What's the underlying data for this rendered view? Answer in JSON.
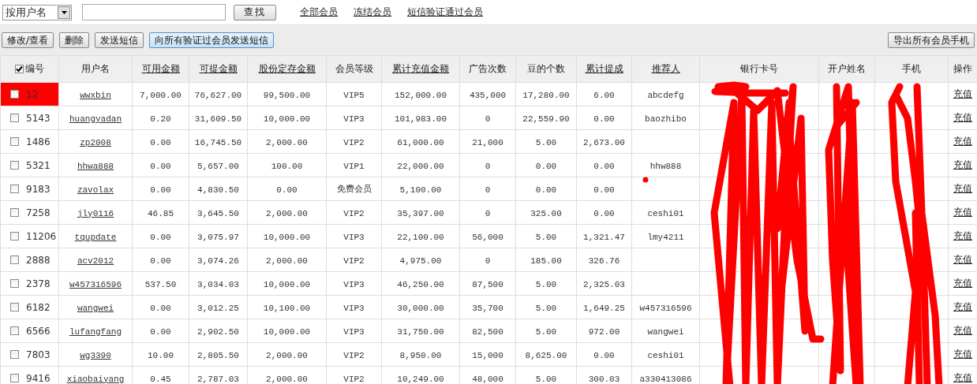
{
  "search": {
    "mode": "按用户名",
    "button": "查找"
  },
  "filter_links": [
    "全部会员",
    "冻结会员",
    "短信验证通过会员"
  ],
  "actions": [
    {
      "label": "修改/查看",
      "kind": "plain"
    },
    {
      "label": "删除",
      "kind": "plain"
    },
    {
      "label": "发送短信",
      "kind": "plain"
    },
    {
      "label": "向所有验证过会员发送短信",
      "kind": "highlight"
    }
  ],
  "export_button": "导出所有会员手机",
  "table": {
    "select_all": {
      "checked": true
    },
    "columns": [
      {
        "label": "编号",
        "sortable": false
      },
      {
        "label": "用户名",
        "sortable": false
      },
      {
        "label": "可用金额",
        "sortable": true
      },
      {
        "label": "可提金额",
        "sortable": true
      },
      {
        "label": "股份定存金额",
        "sortable": true
      },
      {
        "label": "会员等级",
        "sortable": false
      },
      {
        "label": "累计充值金额",
        "sortable": true
      },
      {
        "label": "广告次数",
        "sortable": false
      },
      {
        "label": "豆的个数",
        "sortable": false
      },
      {
        "label": "累计提成",
        "sortable": true
      },
      {
        "label": "推荐人",
        "sortable": true
      },
      {
        "label": "银行卡号",
        "sortable": false
      },
      {
        "label": "开户姓名",
        "sortable": false
      },
      {
        "label": "手机",
        "sortable": false
      },
      {
        "label": "操作",
        "sortable": false
      }
    ],
    "rows": [
      {
        "selected": true,
        "checked": false,
        "id": "12",
        "username": "wwxbin",
        "available": "7,000.00",
        "withdrawable": "76,627.00",
        "deposit": "99,500.00",
        "level": "VIP5",
        "recharge": "152,000.00",
        "ads": "435,000",
        "beans": "17,280.00",
        "commission": "6.00",
        "referrer": "abcdefg",
        "action": "充值"
      },
      {
        "selected": false,
        "checked": false,
        "id": "5143",
        "username": "huangyadan",
        "available": "0.20",
        "withdrawable": "31,609.50",
        "deposit": "10,000.00",
        "level": "VIP3",
        "recharge": "101,983.00",
        "ads": "0",
        "beans": "22,559.90",
        "commission": "0.00",
        "referrer": "baozhibo",
        "action": "充值"
      },
      {
        "selected": false,
        "checked": false,
        "id": "1486",
        "username": "zp2008",
        "available": "0.00",
        "withdrawable": "16,745.50",
        "deposit": "2,000.00",
        "level": "VIP2",
        "recharge": "61,000.00",
        "ads": "21,000",
        "beans": "5.00",
        "commission": "2,673.00",
        "action": "充值"
      },
      {
        "selected": false,
        "checked": false,
        "id": "5321",
        "username": "hhwa888",
        "available": "0.00",
        "withdrawable": "5,657.00",
        "deposit": "100.00",
        "level": "VIP1",
        "recharge": "22,000.00",
        "ads": "0",
        "beans": "0.00",
        "commission": "0.00",
        "referrer": "hhw888",
        "action": "充值"
      },
      {
        "selected": false,
        "checked": false,
        "id": "9183",
        "username": "zavolax",
        "available": "0.00",
        "withdrawable": "4,830.50",
        "deposit": "0.00",
        "level": "免费会员",
        "recharge": "5,100.00",
        "ads": "0",
        "beans": "0.00",
        "commission": "0.00",
        "action": "充值"
      },
      {
        "selected": false,
        "checked": false,
        "id": "7258",
        "username": "jly0116",
        "available": "46.85",
        "withdrawable": "3,645.50",
        "deposit": "2,000.00",
        "level": "VIP2",
        "recharge": "35,397.00",
        "ads": "0",
        "beans": "325.00",
        "commission": "0.00",
        "referrer": "ceshi01",
        "action": "充值"
      },
      {
        "selected": false,
        "checked": false,
        "id": "11206",
        "username": "tqupdate",
        "available": "0.00",
        "withdrawable": "3,075.97",
        "deposit": "10,000.00",
        "level": "VIP3",
        "recharge": "22,100.00",
        "ads": "56,000",
        "beans": "5.00",
        "commission": "1,321.47",
        "referrer": "lmy4211",
        "action": "充值"
      },
      {
        "selected": false,
        "checked": false,
        "id": "2888",
        "username": "acv2012",
        "available": "0.00",
        "withdrawable": "3,074.26",
        "deposit": "2,000.00",
        "level": "VIP2",
        "recharge": "4,975.00",
        "ads": "0",
        "beans": "185.00",
        "commission": "326.76",
        "action": "充值"
      },
      {
        "selected": false,
        "checked": false,
        "id": "2378",
        "username": "w457316596",
        "available": "537.50",
        "withdrawable": "3,034.03",
        "deposit": "10,000.00",
        "level": "VIP3",
        "recharge": "46,250.00",
        "ads": "87,500",
        "beans": "5.00",
        "commission": "2,325.03",
        "action": "充值"
      },
      {
        "selected": false,
        "checked": false,
        "id": "6182",
        "username": "wangwei",
        "available": "0.00",
        "withdrawable": "3,012.25",
        "deposit": "10,100.00",
        "level": "VIP3",
        "recharge": "30,000.00",
        "ads": "35,700",
        "beans": "5.00",
        "commission": "1,649.25",
        "referrer": "w457316596",
        "action": "充值"
      },
      {
        "selected": false,
        "checked": false,
        "id": "6566",
        "username": "lufangfang",
        "available": "0.00",
        "withdrawable": "2,902.50",
        "deposit": "10,000.00",
        "level": "VIP3",
        "recharge": "31,750.00",
        "ads": "82,500",
        "beans": "5.00",
        "commission": "972.00",
        "referrer": "wangwei",
        "action": "充值"
      },
      {
        "selected": false,
        "checked": false,
        "id": "7803",
        "username": "wg3390",
        "available": "10.00",
        "withdrawable": "2,805.50",
        "deposit": "2,000.00",
        "level": "VIP2",
        "recharge": "8,950.00",
        "ads": "15,000",
        "beans": "8,625.00",
        "commission": "0.00",
        "referrer": "ceshi01",
        "action": "充值"
      },
      {
        "selected": false,
        "checked": false,
        "id": "9416",
        "username": "xiaobaiyang",
        "available": "0.45",
        "withdrawable": "2,787.03",
        "deposit": "2,000.00",
        "level": "VIP2",
        "recharge": "10,249.00",
        "ads": "48,000",
        "beans": "5.00",
        "commission": "300.03",
        "referrer": "a330413086",
        "action": "充值"
      }
    ]
  }
}
